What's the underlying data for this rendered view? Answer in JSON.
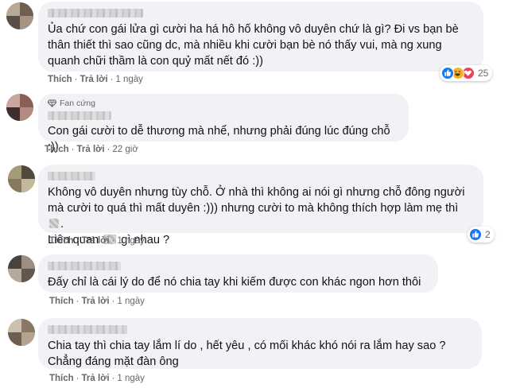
{
  "comments": [
    {
      "text": "Ủa chứ con gái lửa gì cười ha há hô hố không vô duyên chứ là gì? Đi vs bạn bè thân thiết thì sao cũng dc, mà nhiều khi cười bạn bè nó thấy vui, mà ng xung quanh chữi thầm là con quỷ mất nết đó :))",
      "like": "Thích",
      "reply": "Trả lời",
      "time": "1 ngày",
      "reaction_count": "25"
    },
    {
      "badge": "Fan cứng",
      "text": "Con gái cười to dễ thương mà nhể, nhưng phải đúng lúc đúng chỗ :))",
      "like": "Thích",
      "reply": "Trả lời",
      "time": "22 giờ"
    },
    {
      "text_line1": "Không vô duyên nhưng tùy chỗ. Ở nhà thì không ai nói gì nhưng chỗ đông người",
      "text_line2": "mà cười to quá thì mất duyên :))) nhưng cười to mà không thích hợp làm mẹ thì",
      "text_line2_end": ".",
      "text_line3_a": "Liên quan",
      "text_line3_b": "gì nhau ?",
      "like": "Thích",
      "reply": "Trả lời",
      "time": "1 ngày",
      "reaction_count": "2"
    },
    {
      "text": "Đấy chỉ là cái lý do để nó chia tay khi kiếm được con khác ngon hơn thôi",
      "like": "Thích",
      "reply": "Trả lời",
      "time": "1 ngày"
    },
    {
      "text": "Chia tay thì chia tay lắm lí do , hết yêu , có mối khác khó nói ra lắm hay sao ? Chẳng đáng mặt đàn ông",
      "like": "Thích",
      "reply": "Trả lời",
      "time": "1 ngày"
    }
  ],
  "colors": {
    "bubble": "#f0f2f5",
    "meta": "#65676b",
    "like_blue": "#1877f2",
    "love_red": "#f33e58",
    "haha_yellow": "#f7b125"
  },
  "icons": [
    "like-reaction-icon",
    "haha-reaction-icon",
    "love-reaction-icon",
    "diamond-icon"
  ]
}
